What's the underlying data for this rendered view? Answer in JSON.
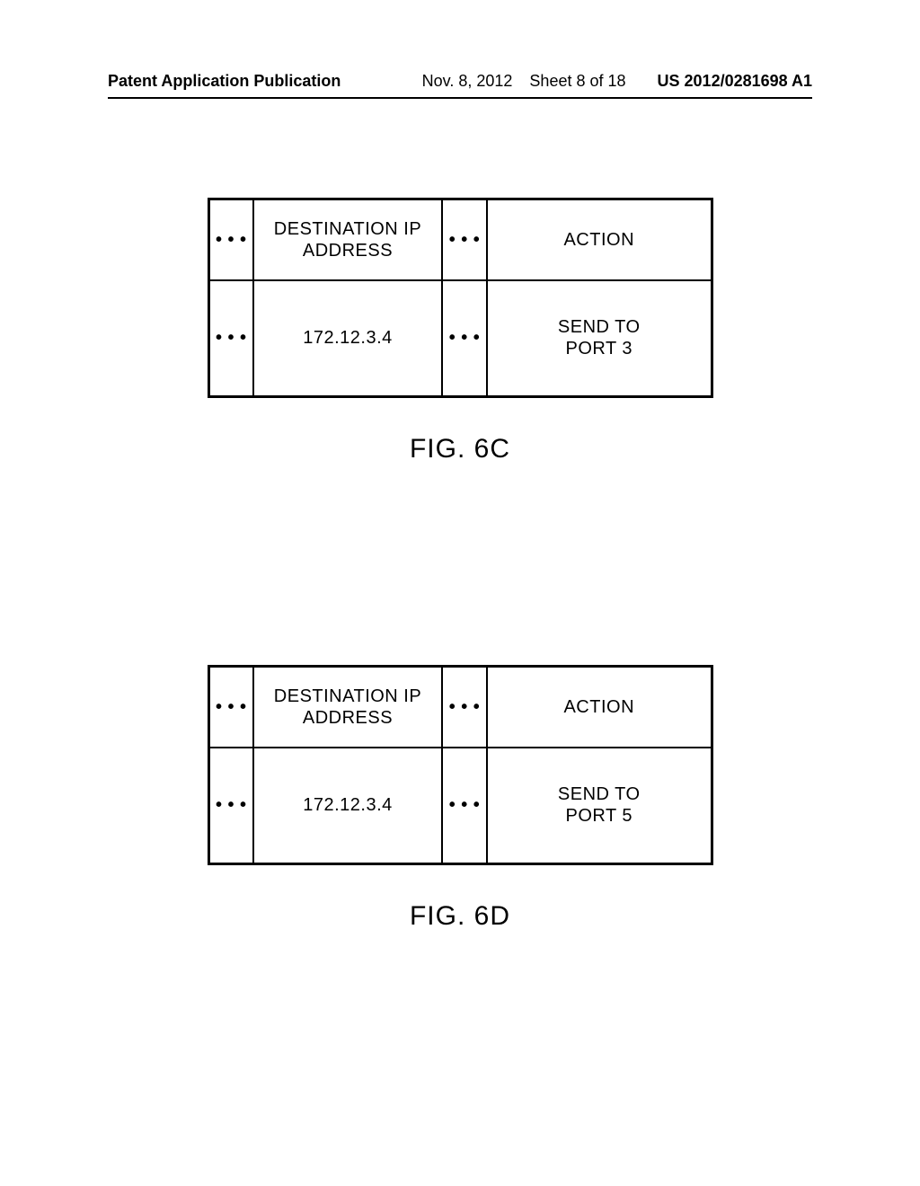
{
  "header": {
    "left": "Patent Application Publication",
    "date": "Nov. 8, 2012",
    "sheet": "Sheet 8 of 18",
    "pubnum": "US 2012/0281698 A1"
  },
  "figures": [
    {
      "label": "FIG. 6C",
      "header": {
        "dots1": "• • •",
        "dest": "DESTINATION IP\nADDRESS",
        "dots2": "• • •",
        "action": "ACTION"
      },
      "row": {
        "dots1": "• • •",
        "dest": "172.12.3.4",
        "dots2": "• • •",
        "action": "SEND TO\nPORT 3"
      }
    },
    {
      "label": "FIG. 6D",
      "header": {
        "dots1": "• • •",
        "dest": "DESTINATION IP\nADDRESS",
        "dots2": "• • •",
        "action": "ACTION"
      },
      "row": {
        "dots1": "• • •",
        "dest": "172.12.3.4",
        "dots2": "• • •",
        "action": "SEND TO\nPORT 5"
      }
    }
  ]
}
